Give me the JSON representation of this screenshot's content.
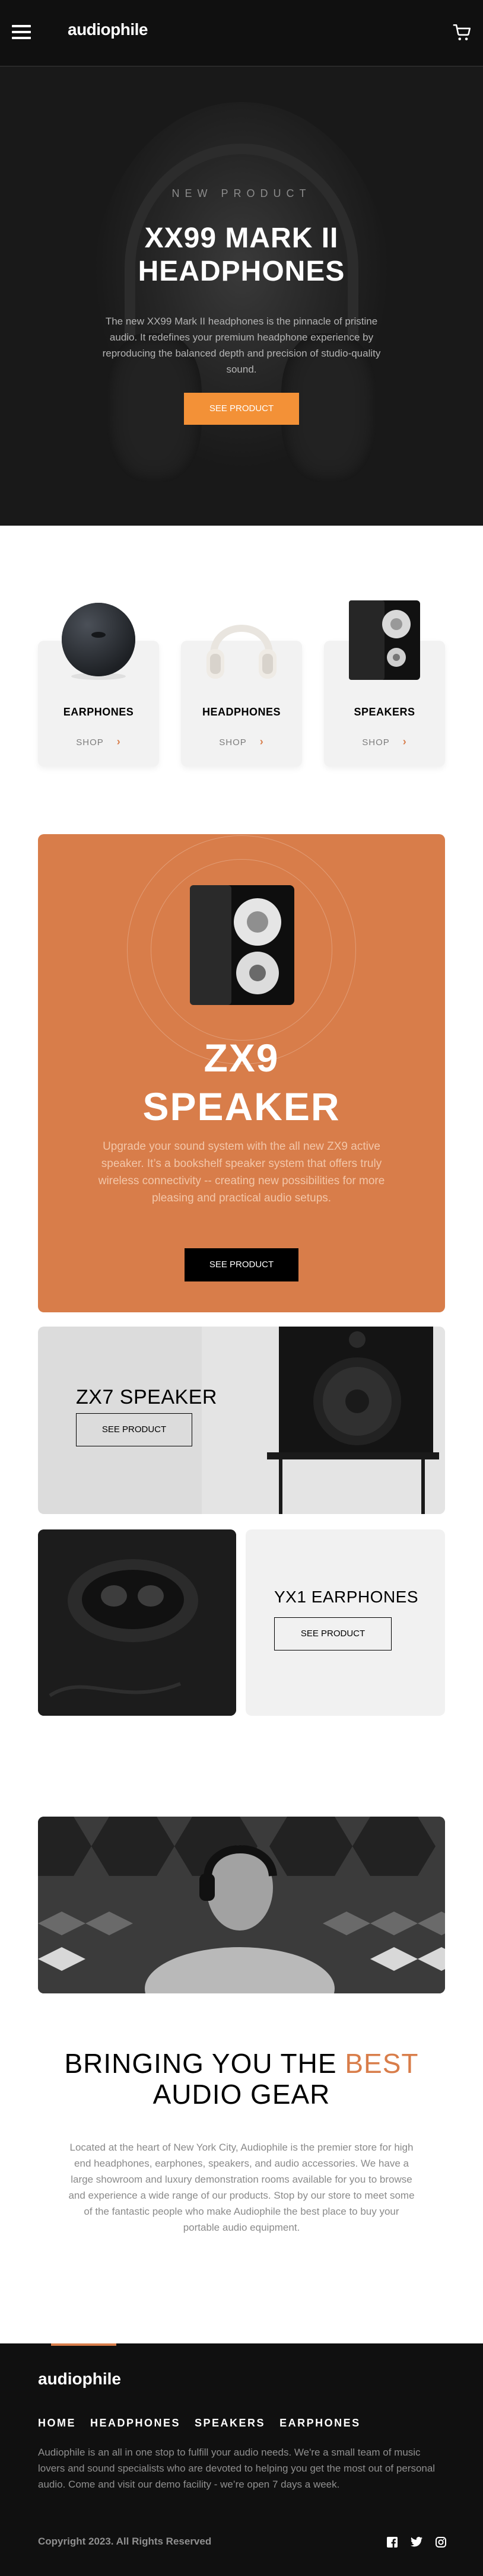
{
  "header": {
    "logo": "audiophile",
    "menu_icon": "hamburger-icon",
    "cart_icon": "cart-icon"
  },
  "hero": {
    "overline": "NEW PRODUCT",
    "title_line1": "XX99 MARK II",
    "title_line2": "HEADPHONES",
    "description": "The new XX99 Mark II headphones is the pinnacle of pristine audio. It redefines your premium headphone experience by reproducing the balanced depth and precision of studio-quality sound.",
    "cta": "SEE PRODUCT",
    "accent": "#f39137"
  },
  "categories": [
    {
      "name": "EARPHONES",
      "shop": "SHOP",
      "icon": "earphones-case-image"
    },
    {
      "name": "HEADPHONES",
      "shop": "SHOP",
      "icon": "headphones-image"
    },
    {
      "name": "SPEAKERS",
      "shop": "SHOP",
      "icon": "speaker-image"
    }
  ],
  "zx9": {
    "title_line1": "ZX9",
    "title_line2": "SPEAKER",
    "description": "Upgrade your sound system with the all new ZX9 active speaker. It’s a bookshelf speaker system that offers truly wireless connectivity -- creating new possibilities for more pleasing and practical audio setups.",
    "cta": "SEE PRODUCT",
    "bg": "#d87d4a"
  },
  "zx7": {
    "title": "ZX7 SPEAKER",
    "cta": "SEE PRODUCT"
  },
  "yx1": {
    "title": "YX1 EARPHONES",
    "cta": "SEE PRODUCT"
  },
  "about": {
    "title_pre": "BRINGING YOU THE ",
    "title_accent": "BEST",
    "title_line2": "AUDIO GEAR",
    "description": "Located at the heart of New York City, Audiophile is the premier store for high end headphones, earphones, speakers, and audio accessories. We have a large showroom and luxury demonstration rooms available for you to browse and experience a wide range of our products. Stop by our store to meet some of the fantastic people who make Audiophile the best place to buy your portable audio equipment."
  },
  "footer": {
    "logo": "audiophile",
    "nav": [
      "HOME",
      "HEADPHONES",
      "SPEAKERS",
      "EARPHONES"
    ],
    "description": "Audiophile is an all in one stop to fulfill your audio needs. We're a small team of music lovers and sound specialists who are devoted to helping you get the most out of personal audio. Come and visit our demo facility - we’re open 7 days a week.",
    "copyright": "Copyright 2023. All Rights Reserved",
    "social": [
      "facebook-icon",
      "twitter-icon",
      "instagram-icon"
    ]
  }
}
